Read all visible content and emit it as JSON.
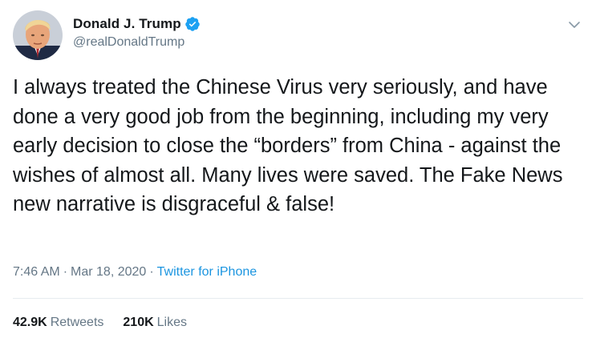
{
  "author": {
    "display_name": "Donald J. Trump",
    "handle": "@realDonaldTrump",
    "verified": true
  },
  "tweet": {
    "text": "I always treated the Chinese Virus very seriously, and have done a very good job from the beginning, including my very early decision to close the “borders” from China - against the wishes of almost all. Many lives were saved. The Fake News new narrative is disgraceful & false!"
  },
  "meta": {
    "time": "7:46 AM",
    "separator": "·",
    "date": "Mar 18, 2020",
    "source": "Twitter for iPhone"
  },
  "stats": {
    "retweets_count": "42.9K",
    "retweets_label": "Retweets",
    "likes_count": "210K",
    "likes_label": "Likes"
  },
  "icons": {
    "verified": "verified-badge-icon",
    "menu": "chevron-down-icon"
  },
  "colors": {
    "text_primary": "#14171a",
    "text_secondary": "#657786",
    "link": "#1b95e0",
    "verified_badge": "#1da1f2",
    "divider": "#e6ecf0"
  }
}
